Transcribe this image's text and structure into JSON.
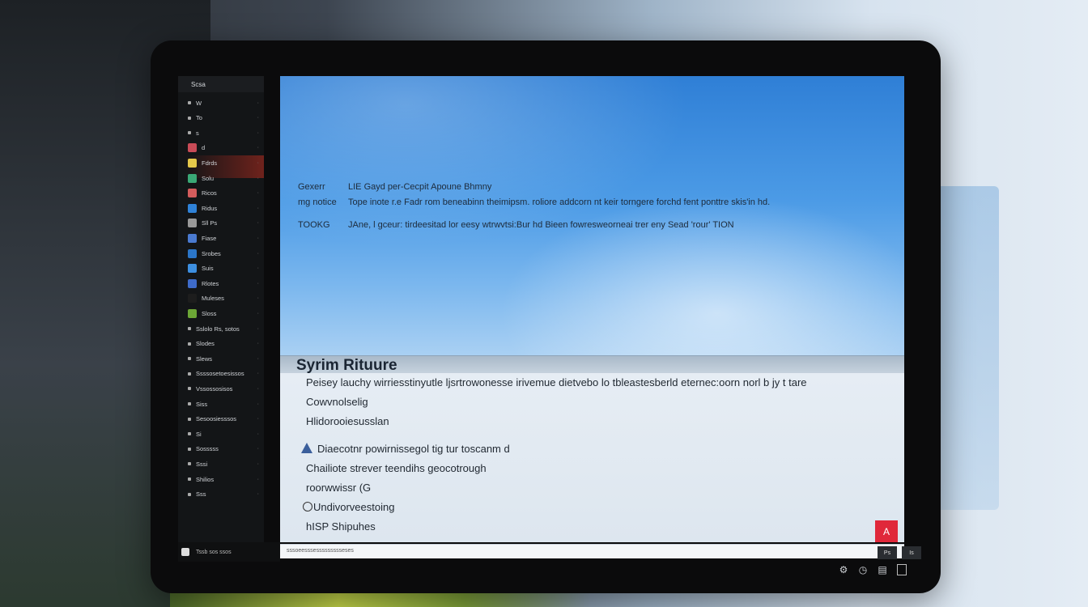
{
  "sidebar": {
    "header": "Scsa",
    "items": [
      {
        "label": "W",
        "icon": "dot"
      },
      {
        "label": "To",
        "icon": "dot"
      },
      {
        "label": "s",
        "icon": "dot"
      },
      {
        "label": "d",
        "icon": "app",
        "color": "#c94b57"
      },
      {
        "label": "Fdrds",
        "icon": "app",
        "color": "#e5c84a"
      },
      {
        "label": "Solu",
        "icon": "app",
        "color": "#3aa876"
      },
      {
        "label": "Ricos",
        "icon": "app",
        "color": "#d35c5c"
      },
      {
        "label": "Ridus",
        "icon": "app",
        "color": "#2f82d8"
      },
      {
        "label": "Sll Ps",
        "icon": "app",
        "color": "#999999"
      },
      {
        "label": "Fiase",
        "icon": "app",
        "color": "#4a7ad0"
      },
      {
        "label": "Srobes",
        "icon": "app",
        "color": "#2b76c9"
      },
      {
        "label": "Suis",
        "icon": "app",
        "color": "#3d8fe0"
      },
      {
        "label": "Rlotes",
        "icon": "app",
        "color": "#3e6bc9"
      },
      {
        "label": "Muleses",
        "icon": "app",
        "color": "#1d1d1d"
      },
      {
        "label": "Sloss",
        "icon": "app",
        "color": "#6ca636"
      },
      {
        "label": "Sslolo Rs, sotos",
        "icon": "dot"
      },
      {
        "label": "Slodes",
        "icon": "dot"
      },
      {
        "label": "Slews",
        "icon": "dot"
      },
      {
        "label": "Ssssosetoesissos",
        "icon": "dot"
      },
      {
        "label": "Vssossosisos",
        "icon": "dot"
      },
      {
        "label": "Siss",
        "icon": "dot"
      },
      {
        "label": "Sesoosiesssos",
        "icon": "dot"
      },
      {
        "label": "Si",
        "icon": "dot"
      },
      {
        "label": "Sosssss",
        "icon": "dot"
      },
      {
        "label": "Sssi",
        "icon": "dot"
      },
      {
        "label": "Shilios",
        "icon": "dot"
      },
      {
        "label": "Sss",
        "icon": "dot"
      }
    ],
    "footer_label": "Tssb sos ssos"
  },
  "hero": {
    "r1_key": "Gexerr",
    "r1_val": "LIE Gayd per-Cecpit Apoune Bhmny",
    "r2_key": "mg notice",
    "r2_val": "Tope inote r.e Fadr rom beneabinn theimipsm. roliore addcorn nt keir torngere forchd fent ponttre skis'in hd.",
    "r3_key": "TOOKG",
    "r3_val": "JAne, l gceur: tirdeesitad lor eesy wtrwvtsi:Bur hd Bieen fowresweorneai trer eny Sead 'rour' TION"
  },
  "section": {
    "title": "Syrim Rituure"
  },
  "content": {
    "line1": "Peisey lauchy wirriesstinyutle ljsrtrowonesse irivemue dietvebo lo tbleastesberld eternec:oorn norl b jy t tare",
    "line2": "Cowvnolselig",
    "line3": "Hlidorooiesusslan",
    "line4": "Diaecotnr powirnissegol tig tur toscanm d",
    "line5": "Chailiote strever teendihs geocotrough",
    "line6": "roorwwissr (G",
    "line7": "Undivorveestoing",
    "line8": "hISP Shipuhes",
    "red_button": "A"
  },
  "statusbar": {
    "text": "sssoeesssessssssssseses"
  },
  "toolbar_right": {
    "b1": "Ps",
    "b2": "Is"
  },
  "tray": {
    "icons": [
      "gear-icon",
      "clock-icon",
      "printer-icon",
      "window-icon"
    ]
  }
}
